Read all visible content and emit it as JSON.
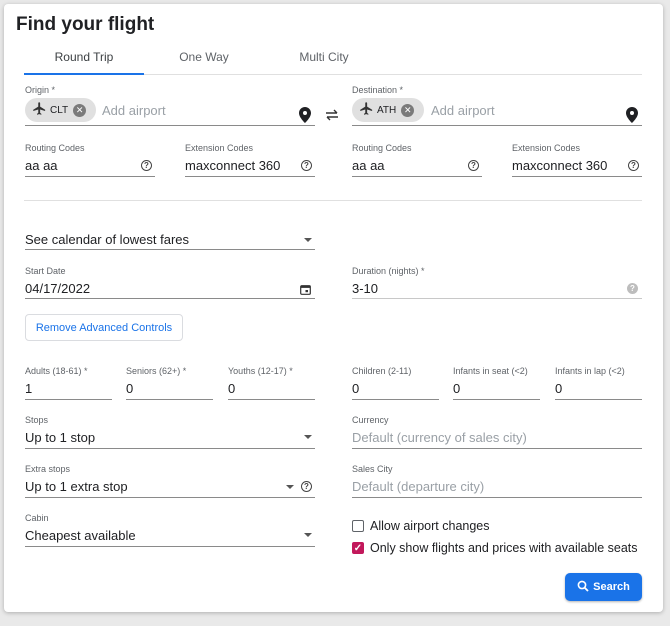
{
  "title": "Find your flight",
  "tabs": [
    "Round Trip",
    "One Way",
    "Multi City"
  ],
  "origin": {
    "label": "Origin *",
    "chip": "CLT",
    "placeholder": "Add airport"
  },
  "destination": {
    "label": "Destination *",
    "chip": "ATH",
    "placeholder": "Add airport"
  },
  "routing_left": {
    "label": "Routing Codes",
    "value": "aa aa"
  },
  "extension_left": {
    "label": "Extension Codes",
    "value": "maxconnect 360"
  },
  "routing_right": {
    "label": "Routing Codes",
    "value": "aa aa"
  },
  "extension_right": {
    "label": "Extension Codes",
    "value": "maxconnect 360"
  },
  "calendar_select": "See calendar of lowest fares",
  "start_date": {
    "label": "Start Date",
    "value": "04/17/2022"
  },
  "duration": {
    "label": "Duration (nights) *",
    "value": "3-10"
  },
  "advanced_button": "Remove Advanced Controls",
  "passengers": [
    {
      "label": "Adults (18-61) *",
      "value": "1"
    },
    {
      "label": "Seniors (62+) *",
      "value": "0"
    },
    {
      "label": "Youths (12-17) *",
      "value": "0"
    },
    {
      "label": "Children (2-11)",
      "value": "0"
    },
    {
      "label": "Infants in seat (<2)",
      "value": "0"
    },
    {
      "label": "Infants in lap (<2)",
      "value": "0"
    }
  ],
  "stops": {
    "label": "Stops",
    "value": "Up to 1 stop"
  },
  "currency": {
    "label": "Currency",
    "placeholder": "Default (currency of sales city)"
  },
  "extra_stops": {
    "label": "Extra stops",
    "value": "Up to 1 extra stop"
  },
  "sales_city": {
    "label": "Sales City",
    "placeholder": "Default (departure city)"
  },
  "cabin": {
    "label": "Cabin",
    "value": "Cheapest available"
  },
  "allow_airport_changes": {
    "label": "Allow airport changes",
    "checked": false
  },
  "only_available": {
    "label": "Only show flights and prices with available seats",
    "checked": true
  },
  "search_button": "Search",
  "colors": {
    "accent": "#1a73e8",
    "checkbox": "#c2185b"
  }
}
